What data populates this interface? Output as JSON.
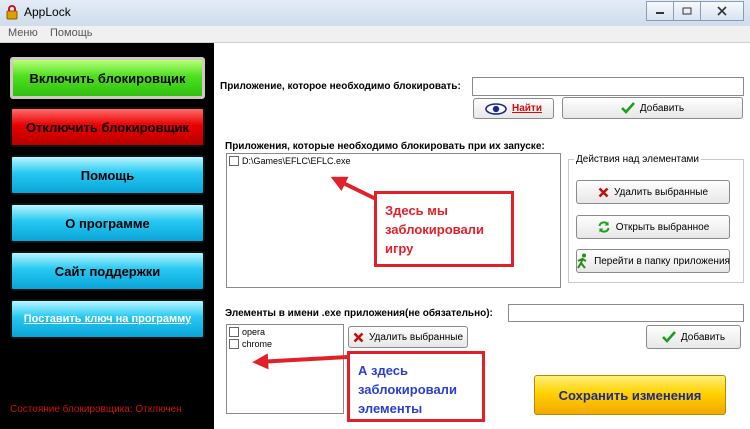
{
  "window": {
    "title": "AppLock"
  },
  "menu": [
    "Меню",
    "Помощь"
  ],
  "sidebar": {
    "enable": "Включить блокировщик",
    "disable": "Отключить блокировщик",
    "help": "Помощь",
    "about": "О программе",
    "support": "Сайт поддержки",
    "set_key": "Поставить ключ на программу",
    "status": "Состояние блокировщика: Отключен"
  },
  "app_block": {
    "label": "Приложение, которое необходимо блокировать:",
    "input_value": "",
    "find": "Найти",
    "add": "Добавить"
  },
  "apps_list": {
    "label": "Приложения, которые необходимо блокировать при их запуске:",
    "items": [
      "D:\\Games\\EFLC\\EFLC.exe"
    ]
  },
  "actions": {
    "title": "Действия над элементами",
    "delete": "Удалить выбранные",
    "open": "Открыть выбранное",
    "goto": "Перейти в папку приложения"
  },
  "name_block": {
    "label": "Элементы в имени .exe приложения(не обязательно):",
    "input_value": "",
    "delete": "Удалить выбранные",
    "add": "Добавить",
    "items": [
      "opera",
      "chrome"
    ]
  },
  "save": "Сохранить изменения",
  "annotations": {
    "one": [
      "Здесь мы",
      "заблокировали",
      "игру"
    ],
    "two": [
      "А здесь",
      "заблокировали",
      "элементы"
    ]
  },
  "colors": {
    "annotation_border": "#e1202a",
    "annotation_text_red": "#e1202a",
    "annotation_text_blue": "#2a3fd0",
    "status_text": "#d01010"
  }
}
